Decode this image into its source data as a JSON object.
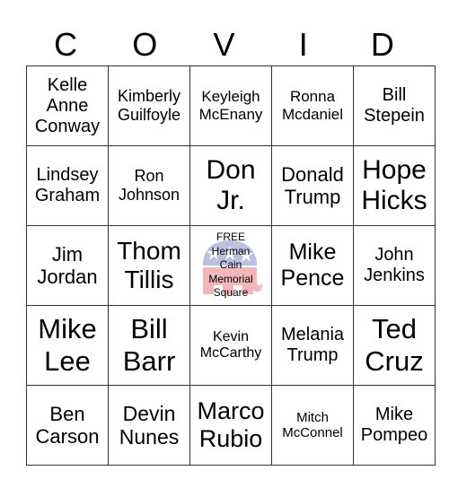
{
  "title_letters": [
    "C",
    "O",
    "V",
    "I",
    "D"
  ],
  "cells": [
    [
      "Kelle Anne Conway",
      "Kimberly Guilfoyle",
      "Keyleigh McEnany",
      "Ronna Mcdaniel",
      "Bill Stepein"
    ],
    [
      "Lindsey Graham",
      "Ron Johnson",
      "Don Jr.",
      "Donald Trump",
      "Hope Hicks"
    ],
    [
      "Jim Jordan",
      "Thom Tillis",
      "FREE Herman Cain Memorial Square",
      "Mike Pence",
      "John Jenkins"
    ],
    [
      "Mike Lee",
      "Bill Barr",
      "Kevin McCarthy",
      "Melania Trump",
      "Ted Cruz"
    ],
    [
      "Ben Carson",
      "Devin Nunes",
      "Marco Rubio",
      "Mitch McConnel",
      "Mike Pompeo"
    ]
  ],
  "free_space": {
    "lines": [
      "FREE",
      "Herman",
      "Cain",
      "Memorial",
      "Square"
    ],
    "icon": "republican-elephant-logo",
    "colors": {
      "blue": "#3b4fa8",
      "red": "#d8333a"
    }
  }
}
